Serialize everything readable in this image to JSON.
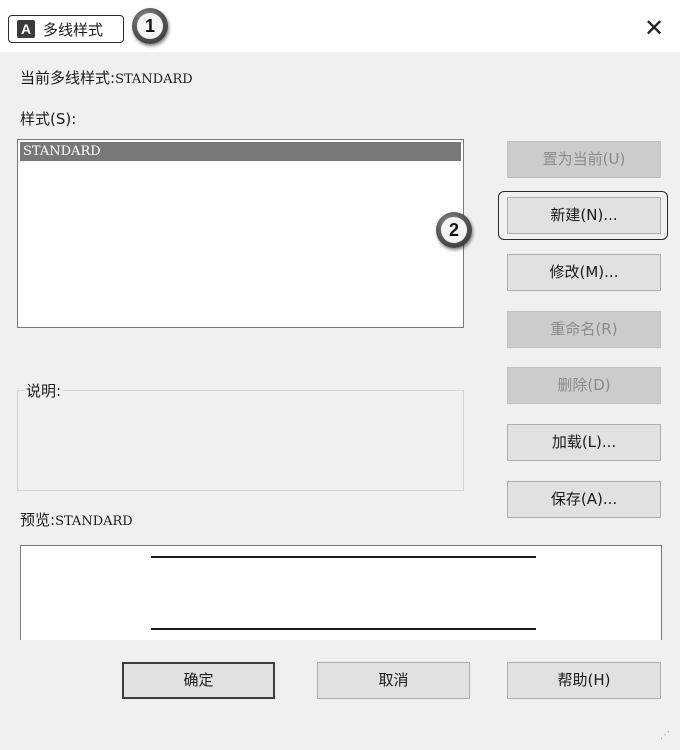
{
  "window": {
    "title": "多线样式",
    "app_icon": "A",
    "close_label": "✕",
    "annotation_1": "1",
    "annotation_2": "2"
  },
  "current_style": {
    "label": "当前多线样式:",
    "value": "STANDARD"
  },
  "styles": {
    "label": "样式(S):",
    "items": [
      "STANDARD"
    ],
    "selected": "STANDARD"
  },
  "description": {
    "label": "说明:",
    "value": ""
  },
  "preview": {
    "label": "预览:",
    "value": "STANDARD"
  },
  "side_buttons": {
    "set_current": "置为当前(U)",
    "new": "新建(N)...",
    "modify": "修改(M)...",
    "rename": "重命名(R)",
    "delete": "删除(D)",
    "load": "加载(L)...",
    "save": "保存(A)..."
  },
  "footer_buttons": {
    "ok": "确定",
    "cancel": "取消",
    "help": "帮助(H)"
  },
  "colors": {
    "selection": "#787878",
    "disabled_button": "#cccccc",
    "button": "#e1e1e1"
  }
}
